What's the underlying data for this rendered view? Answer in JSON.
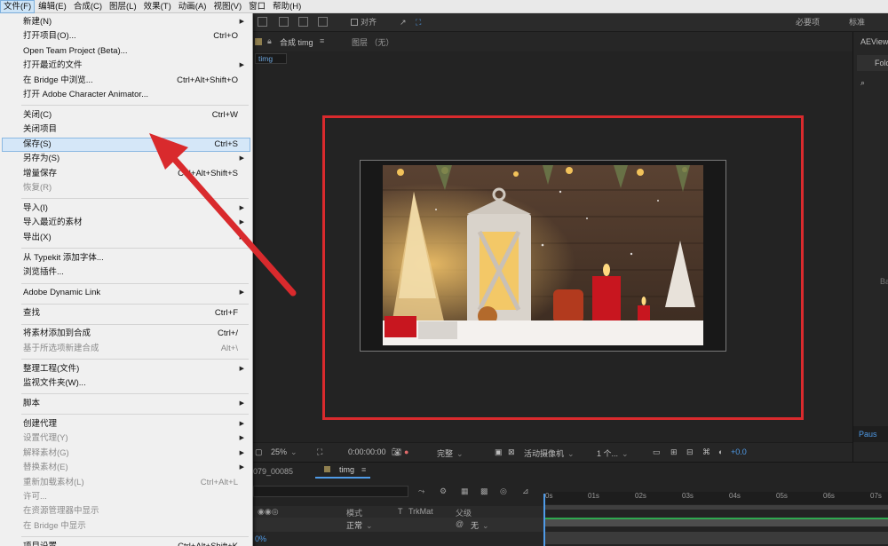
{
  "menubar": {
    "items": [
      "文件(F)",
      "编辑(E)",
      "合成(C)",
      "图层(L)",
      "效果(T)",
      "动画(A)",
      "视图(V)",
      "窗口",
      "帮助(H)"
    ]
  },
  "toolbar": {
    "snap_label": "对齐",
    "workspace_required": "必要项",
    "workspace_standard": "标准"
  },
  "comp_header": {
    "comp_label": "合成 timg",
    "layer_label": "图层 （无）",
    "comp_chip": "timg"
  },
  "viewer_bar": {
    "zoom": "25%",
    "timecode": "0:00:00:00",
    "resolution": "完整",
    "camera": "活动摄像机",
    "views": "1 个...",
    "exposure": "+0.0"
  },
  "right_panel": {
    "title": "AEViewe",
    "folder_button": "Fold",
    "partial_label": "Ba",
    "pause_label": "Paus"
  },
  "timeline": {
    "prev_tab": "079_00085",
    "active_tab": "timg",
    "col_mode": "模式",
    "col_t": "T",
    "col_trkmat": "TrkMat",
    "col_parent": "父级",
    "row_mode": "正常",
    "row_parent": "无",
    "percent": "0%",
    "ticks": [
      "0s",
      "01s",
      "02s",
      "03s",
      "04s",
      "05s",
      "06s",
      "07s"
    ]
  },
  "file_menu": {
    "items": [
      {
        "label": "新建(N)",
        "shortcut": "",
        "submenu": true,
        "disabled": false
      },
      {
        "label": "打开项目(O)...",
        "shortcut": "Ctrl+O",
        "submenu": false,
        "disabled": false
      },
      {
        "label": "Open Team Project (Beta)...",
        "shortcut": "",
        "submenu": false,
        "disabled": false
      },
      {
        "label": "打开最近的文件",
        "shortcut": "",
        "submenu": true,
        "disabled": false
      },
      {
        "label": "在 Bridge 中浏览...",
        "shortcut": "Ctrl+Alt+Shift+O",
        "submenu": false,
        "disabled": false
      },
      {
        "label": "打开 Adobe Character Animator...",
        "shortcut": "",
        "submenu": false,
        "disabled": false
      },
      {
        "sep": true
      },
      {
        "label": "关闭(C)",
        "shortcut": "Ctrl+W",
        "submenu": false,
        "disabled": false
      },
      {
        "label": "关闭项目",
        "shortcut": "",
        "submenu": false,
        "disabled": false
      },
      {
        "label": "保存(S)",
        "shortcut": "Ctrl+S",
        "submenu": false,
        "disabled": false,
        "highlight": true
      },
      {
        "label": "另存为(S)",
        "shortcut": "",
        "submenu": true,
        "disabled": false
      },
      {
        "label": "增量保存",
        "shortcut": "Ctrl+Alt+Shift+S",
        "submenu": false,
        "disabled": false
      },
      {
        "label": "恢复(R)",
        "shortcut": "",
        "submenu": false,
        "disabled": true
      },
      {
        "sep": true
      },
      {
        "label": "导入(I)",
        "shortcut": "",
        "submenu": true,
        "disabled": false
      },
      {
        "label": "导入最近的素材",
        "shortcut": "",
        "submenu": true,
        "disabled": false
      },
      {
        "label": "导出(X)",
        "shortcut": "",
        "submenu": true,
        "disabled": false
      },
      {
        "sep": true
      },
      {
        "label": "从 Typekit 添加字体...",
        "shortcut": "",
        "submenu": false,
        "disabled": false
      },
      {
        "label": "浏览插件...",
        "shortcut": "",
        "submenu": false,
        "disabled": false
      },
      {
        "sep": true
      },
      {
        "label": "Adobe Dynamic Link",
        "shortcut": "",
        "submenu": true,
        "disabled": false
      },
      {
        "sep": true
      },
      {
        "label": "查找",
        "shortcut": "Ctrl+F",
        "submenu": false,
        "disabled": false
      },
      {
        "sep": true
      },
      {
        "label": "将素材添加到合成",
        "shortcut": "Ctrl+/",
        "submenu": false,
        "disabled": false
      },
      {
        "label": "基于所选项新建合成",
        "shortcut": "Alt+\\",
        "submenu": false,
        "disabled": true
      },
      {
        "sep": true
      },
      {
        "label": "整理工程(文件)",
        "shortcut": "",
        "submenu": true,
        "disabled": false
      },
      {
        "label": "监视文件夹(W)...",
        "shortcut": "",
        "submenu": false,
        "disabled": false
      },
      {
        "sep": true
      },
      {
        "label": "脚本",
        "shortcut": "",
        "submenu": true,
        "disabled": false
      },
      {
        "sep": true
      },
      {
        "label": "创建代理",
        "shortcut": "",
        "submenu": true,
        "disabled": false
      },
      {
        "label": "设置代理(Y)",
        "shortcut": "",
        "submenu": true,
        "disabled": true
      },
      {
        "label": "解释素材(G)",
        "shortcut": "",
        "submenu": true,
        "disabled": true
      },
      {
        "label": "替换素材(E)",
        "shortcut": "",
        "submenu": true,
        "disabled": true
      },
      {
        "label": "重新加载素材(L)",
        "shortcut": "Ctrl+Alt+L",
        "submenu": false,
        "disabled": true
      },
      {
        "label": "许可...",
        "shortcut": "",
        "submenu": false,
        "disabled": true
      },
      {
        "label": "在资源管理器中显示",
        "shortcut": "",
        "submenu": false,
        "disabled": true
      },
      {
        "label": "在 Bridge 中显示",
        "shortcut": "",
        "submenu": false,
        "disabled": true
      },
      {
        "sep": true
      },
      {
        "label": "项目设置...",
        "shortcut": "Ctrl+Alt+Shift+K",
        "submenu": false,
        "disabled": false
      }
    ]
  },
  "colors": {
    "annotation_red": "#d92a2d",
    "accent_blue": "#4f9be8",
    "menu_highlight": "#d5e7f8"
  }
}
